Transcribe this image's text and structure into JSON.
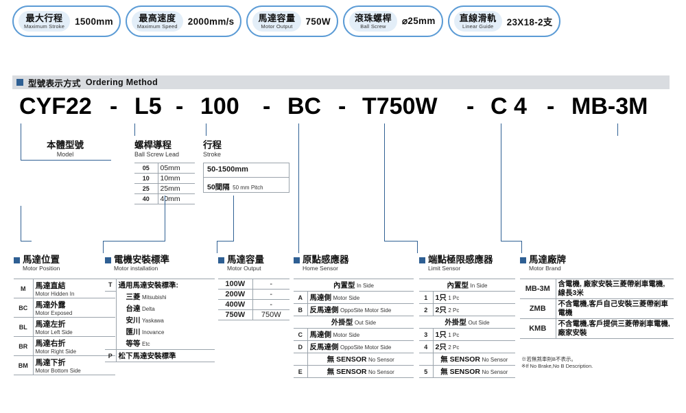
{
  "specs": [
    {
      "cn": "最大行程",
      "en": "Maximum Stroke",
      "value": "1500mm"
    },
    {
      "cn": "最高速度",
      "en": "Maximum Speed",
      "value": "2000mm/s"
    },
    {
      "cn": "馬達容量",
      "en": "Motor Output",
      "value": "750W"
    },
    {
      "cn": "滾珠螺桿",
      "en": "Ball Screw",
      "value": "⌀25mm"
    },
    {
      "cn": "直線滑軌",
      "en": "Linear Guide",
      "value": "23X18-2支"
    }
  ],
  "section": {
    "cn": "型號表示方式",
    "en": "Ordering Method"
  },
  "code": [
    "CYF22",
    "-",
    "L5",
    "-",
    "100",
    "-",
    "BC",
    "-",
    "T750W",
    "-",
    "C 4",
    "-",
    "MB-3M"
  ],
  "groups": {
    "model": {
      "cn": "本體型號",
      "en": "Model"
    },
    "lead": {
      "cn": "螺桿導程",
      "en": "Ball Screw Lead",
      "rows": [
        [
          "05",
          "05mm"
        ],
        [
          "10",
          "10mm"
        ],
        [
          "25",
          "25mm"
        ],
        [
          "40",
          "40mm"
        ]
      ]
    },
    "stroke": {
      "cn": "行程",
      "en": "Stroke",
      "row1": "50-1500mm",
      "row2cn": "50間隔",
      "row2en": "50 mm Pitch"
    },
    "motor_position": {
      "cn": "馬達位置",
      "en": "Motor Position",
      "rows": [
        {
          "k": "M",
          "cn": "馬達直結",
          "en": "Motor Hidden In"
        },
        {
          "k": "BC",
          "cn": "馬達外露",
          "en": "Motor Exposed"
        },
        {
          "k": "BL",
          "cn": "馬達左折",
          "en": "Motor Left Side"
        },
        {
          "k": "BR",
          "cn": "馬達右折",
          "en": "Motor Right Side"
        },
        {
          "k": "BM",
          "cn": "馬達下折",
          "en": "Motor Bottom Side"
        }
      ]
    },
    "motor_installation": {
      "cn": "電機安裝標準",
      "en": "Motor installation",
      "rows": [
        {
          "k": "T",
          "cn": "通用馬達安裝標準:",
          "en": ""
        },
        {
          "k": "",
          "cn": "三菱",
          "en": "Mitsubishi"
        },
        {
          "k": "",
          "cn": "台達",
          "en": "Delta"
        },
        {
          "k": "",
          "cn": "安川",
          "en": "Yaskawa"
        },
        {
          "k": "",
          "cn": "匯川",
          "en": "Inovance"
        },
        {
          "k": "",
          "cn": "等等",
          "en": "Etc"
        },
        {
          "k": "P",
          "cn": "松下馬達安裝標準",
          "en": ""
        }
      ]
    },
    "motor_output": {
      "cn": "馬達容量",
      "en": "Motor Output",
      "rows": [
        [
          "100W",
          "-"
        ],
        [
          "200W",
          "-"
        ],
        [
          "400W",
          "-"
        ],
        [
          "750W",
          "750W"
        ]
      ]
    },
    "home_sensor": {
      "cn": "原點感應器",
      "en": "Home Sensor",
      "header1cn": "內置型",
      "header1en": "In Side",
      "header2cn": "外掛型",
      "header2en": "Out Side",
      "rows": [
        {
          "k": "A",
          "cn": "馬達側",
          "en": "Motor Side"
        },
        {
          "k": "B",
          "cn": "反馬達側",
          "en": "OppoSite Motor Side"
        },
        {
          "k": "C",
          "cn": "馬達側",
          "en": "Motor Side"
        },
        {
          "k": "D",
          "cn": "反馬達側",
          "en": "OppoSite Motor Side"
        },
        {
          "k": "",
          "cn": "無 SENSOR",
          "en": "No Sensor"
        },
        {
          "k": "E",
          "cn": "無 SENSOR",
          "en": "No Sensor"
        }
      ]
    },
    "limit_sensor": {
      "cn": "端點極限感應器",
      "en": "Limit Sensor",
      "header1cn": "內置型",
      "header1en": "In Side",
      "header2cn": "外掛型",
      "header2en": "Out Side",
      "rows": [
        {
          "k": "1",
          "cn": "1只",
          "en": "1 Pc"
        },
        {
          "k": "2",
          "cn": "2只",
          "en": "2 Pc"
        },
        {
          "k": "3",
          "cn": "1只",
          "en": "1 Pc"
        },
        {
          "k": "4",
          "cn": "2只",
          "en": "2 Pc"
        },
        {
          "k": "",
          "cn": "無 SENSOR",
          "en": "No Sensor"
        },
        {
          "k": "5",
          "cn": "無 SENSOR",
          "en": "No Sensor"
        }
      ]
    },
    "motor_brand": {
      "cn": "馬達廠牌",
      "en": "Motor Brand",
      "rows": [
        {
          "k": "MB-3M",
          "cn": "含電機, 廠家安裝三菱帶剎車電機, 線長3米"
        },
        {
          "k": "ZMB",
          "cn": "不含電機,客戶自己安裝三菱帶剎車電機"
        },
        {
          "k": "KMB",
          "cn": "不含電機,客戶提供三菱帶剎車電機,廠家安裝"
        }
      ],
      "note_cn": "※若無煞車則B不表示。",
      "note_en": "※If No Brake,No B Description."
    }
  }
}
